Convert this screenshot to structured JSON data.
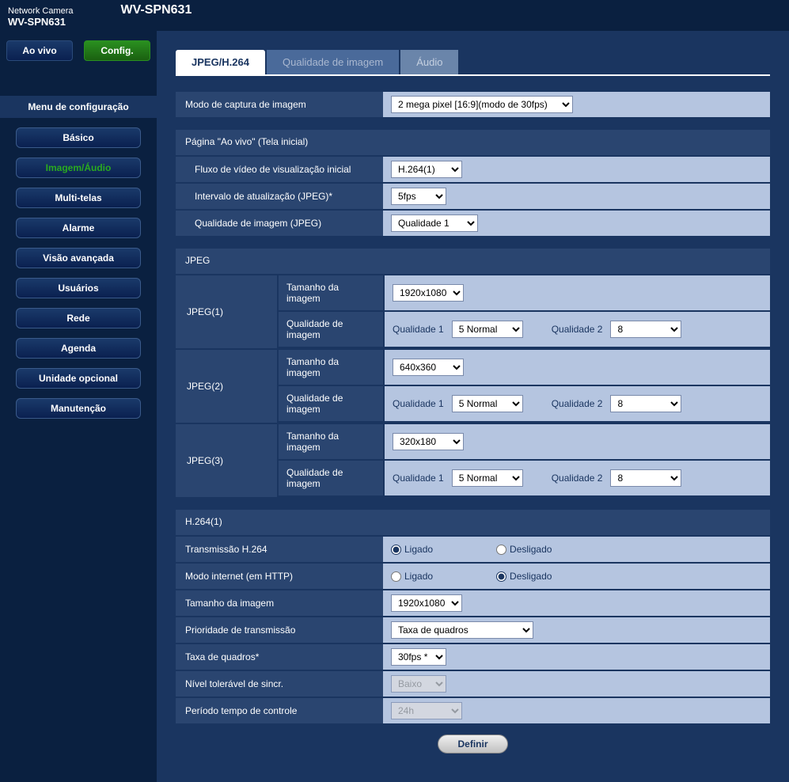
{
  "header": {
    "brand_small": "Network Camera",
    "model": "WV-SPN631",
    "title": "WV-SPN631"
  },
  "mode": {
    "live": "Ao vivo",
    "config": "Config."
  },
  "menu": {
    "title": "Menu de configuração",
    "items": [
      "Básico",
      "Imagem/Áudio",
      "Multi-telas",
      "Alarme",
      "Visão avançada",
      "Usuários",
      "Rede",
      "Agenda",
      "Unidade opcional",
      "Manutenção"
    ]
  },
  "tabs": {
    "t1": "JPEG/H.264",
    "t2": "Qualidade de imagem",
    "t3": "Áudio"
  },
  "capture": {
    "label": "Modo de captura de imagem",
    "value": "2 mega pixel [16:9](modo de 30fps)"
  },
  "live_page": {
    "head": "Página \"Ao vivo\" (Tela inicial)",
    "stream_label": "Fluxo de vídeo de visualização inicial",
    "stream_value": "H.264(1)",
    "refresh_label": "Intervalo de atualização (JPEG)*",
    "refresh_value": "5fps",
    "quality_label": "Qualidade de imagem (JPEG)",
    "quality_value": "Qualidade 1"
  },
  "jpeg": {
    "head": "JPEG",
    "rows": [
      {
        "name": "JPEG(1)",
        "size": "1920x1080",
        "q1": "5 Normal",
        "q2": "8"
      },
      {
        "name": "JPEG(2)",
        "size": "640x360",
        "q1": "5 Normal",
        "q2": "8"
      },
      {
        "name": "JPEG(3)",
        "size": "320x180",
        "q1": "5 Normal",
        "q2": "8"
      }
    ],
    "size_label": "Tamanho da imagem",
    "qual_label": "Qualidade de imagem",
    "q1_label": "Qualidade 1",
    "q2_label": "Qualidade 2"
  },
  "h264": {
    "head": "H.264(1)",
    "trans_label": "Transmissão H.264",
    "on": "Ligado",
    "off": "Desligado",
    "internet_label": "Modo internet (em HTTP)",
    "size_label": "Tamanho da imagem",
    "size_value": "1920x1080",
    "priority_label": "Prioridade de transmissão",
    "priority_value": "Taxa de quadros",
    "rate_label": "Taxa de quadros*",
    "rate_value": "30fps *",
    "sync_label": "Nível tolerável de sincr.",
    "sync_value": "Baixo",
    "period_label": "Período tempo de controle",
    "period_value": "24h"
  },
  "submit": "Definir"
}
